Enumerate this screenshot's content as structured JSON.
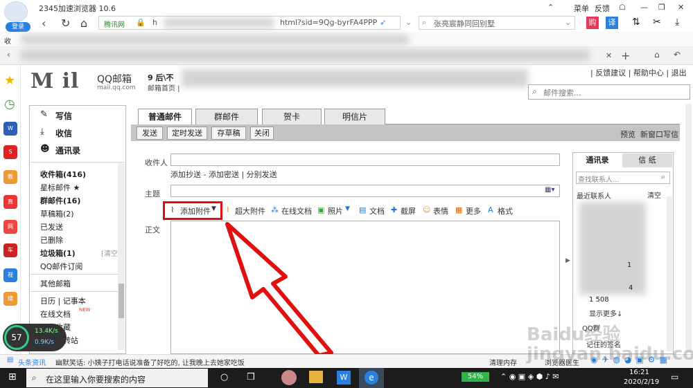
{
  "browser": {
    "title": "2345加速浏览器 10.6",
    "login": "登录",
    "menu": "菜单",
    "feedback": "反馈",
    "bookmark_label": "收",
    "url": "html?sid=9Qg-byrFA4PPP",
    "url_prefix": "h",
    "secure_label": "腾讯网",
    "search_suggestion": "张亮宸静同回别墅",
    "translate": "译",
    "red_badge": "购"
  },
  "mail": {
    "logo_text": "M il",
    "logo_cn": "QQ邮箱",
    "logo_domain": "mail.qq.com",
    "user_line": "9 后\\不",
    "home_line": "邮箱首页 |",
    "top_links": "| 反馈建议 | 帮助中心 | 退出",
    "search_placeholder": "邮件搜索..."
  },
  "nav": {
    "compose": "写信",
    "inbox": "收信",
    "contacts": "通讯录",
    "folders": [
      {
        "label": "收件箱(416)",
        "bold": true
      },
      {
        "label": "星标邮件 ★",
        "bold": false
      },
      {
        "label": "群邮件(16)",
        "bold": true
      },
      {
        "label": "草稿箱(2)",
        "bold": false
      },
      {
        "label": "已发送",
        "bold": false
      },
      {
        "label": "已删除",
        "bold": false
      },
      {
        "label": "垃圾箱(1)",
        "bold": true
      },
      {
        "label": "QQ邮件订阅",
        "bold": false
      }
    ],
    "clear": "[清空]",
    "other": "其他邮箱",
    "calendar": "日历 | 记事本",
    "online_docs": "在线文档",
    "new_badge": "NEW",
    "attach_favs": "附件收藏",
    "file_transfer": "文件中转站"
  },
  "compose": {
    "tabs": [
      "普通邮件",
      "群邮件",
      "贺卡",
      "明信片"
    ],
    "buttons": [
      "发送",
      "定时发送",
      "存草稿",
      "关闭"
    ],
    "preview": "预览",
    "new_window": "新窗口写信",
    "to_label": "收件人",
    "cc_links": "添加抄送 - 添加密送 | 分别发送",
    "subject_label": "主题",
    "body_label": "正文",
    "tools": [
      "添加附件",
      "超大附件",
      "在线文档",
      "照片",
      "文档",
      "截屏",
      "表情",
      "更多",
      "格式"
    ]
  },
  "contacts": {
    "tab_contacts": "通讯录",
    "tab_stationery": "信 纸",
    "search_placeholder": "查找联系人...",
    "recent": "最近联系人",
    "clear": "清空",
    "partial_1": "1",
    "partial_2": "4",
    "partial_3": "1      508",
    "show_more": "显示更多↓",
    "qq_group": "QQ群",
    "sign_label": "记住的签名"
  },
  "statusbar": {
    "news": "头条资讯",
    "ticker": "幽默笑话: 小姨子打电话说准备了好吃的, 让我晚上去她家吃饭",
    "clean_mem": "清理内存",
    "browser_doctor": "浏览器医生"
  },
  "speed": {
    "percent": "57",
    "up": "13.4K/s",
    "down": "0.9K/s"
  },
  "taskbar": {
    "search_placeholder": "在这里输入你要搜索的内容",
    "battery": "54%",
    "time": "16:21",
    "date": "2020/2/19",
    "watermark": "Baidu经验 jingyan.baidu.com"
  },
  "colors": {
    "highlight": "#e20e0e",
    "arrow": "#e01010",
    "link_blue": "#2b7fe0"
  }
}
